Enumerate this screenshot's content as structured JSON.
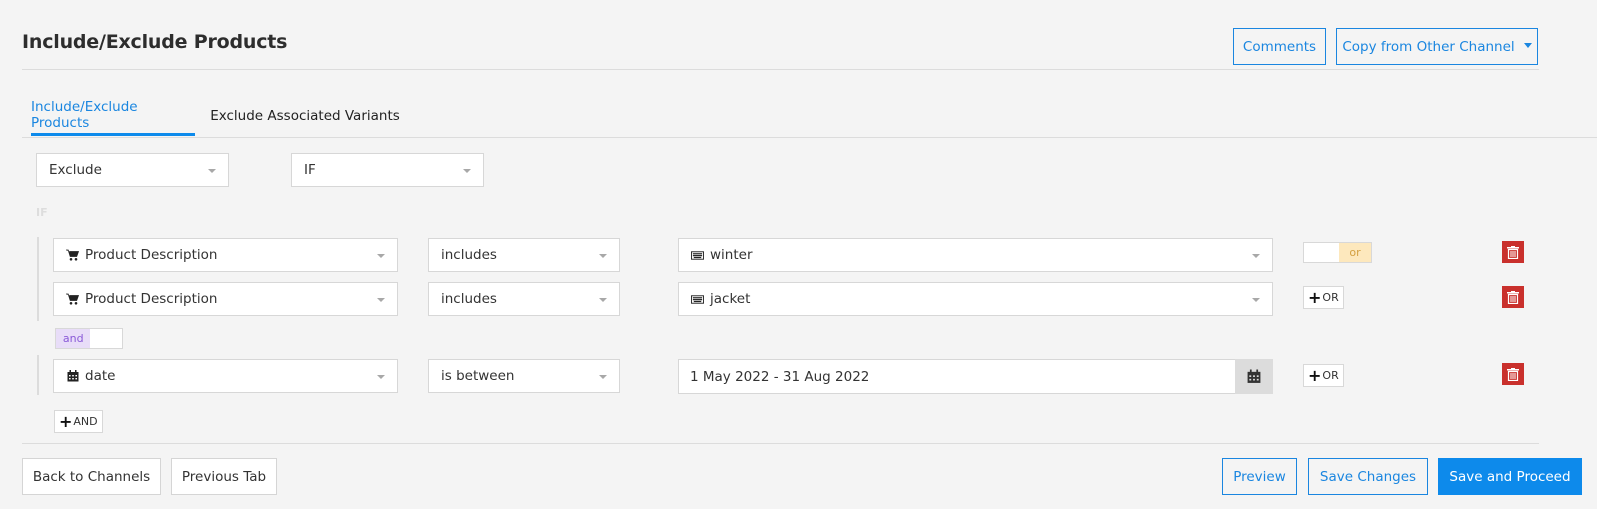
{
  "header": {
    "title": "Include/Exclude Products",
    "comments_label": "Comments",
    "copy_label": "Copy from Other Channel"
  },
  "tabs": [
    {
      "label": "Include/Exclude Products",
      "active": true
    },
    {
      "label": "Exclude Associated Variants",
      "active": false
    }
  ],
  "top_selects": {
    "mode": "Exclude",
    "condition": "IF"
  },
  "if_label": "IF",
  "rules": [
    {
      "field_icon": "cart-icon",
      "field": "Product Description",
      "operator": "includes",
      "value_icon": "keyboard-icon",
      "value": "winter",
      "connector": "or"
    },
    {
      "field_icon": "cart-icon",
      "field": "Product Description",
      "operator": "includes",
      "value_icon": "keyboard-icon",
      "value": "jacket",
      "connector": "+OR"
    },
    {
      "field_icon": "calendar-icon",
      "field": "date",
      "operator": "is between",
      "value": "1 May 2022 - 31 Aug 2022",
      "connector": "+OR"
    }
  ],
  "toggles": {
    "or_label": "or",
    "and_label": "and"
  },
  "add_or_label": "OR",
  "add_and_label": "AND",
  "footer": {
    "back_label": "Back to Channels",
    "previous_label": "Previous Tab",
    "preview_label": "Preview",
    "save_changes_label": "Save Changes",
    "save_proceed_label": "Save and Proceed"
  },
  "colors": {
    "accent": "#0d8aeb",
    "danger": "#c9302c",
    "or_bg": "#fde8bd",
    "or_text": "#d4a041",
    "and_bg": "#e8ddf8",
    "and_text": "#8a5ad8"
  }
}
